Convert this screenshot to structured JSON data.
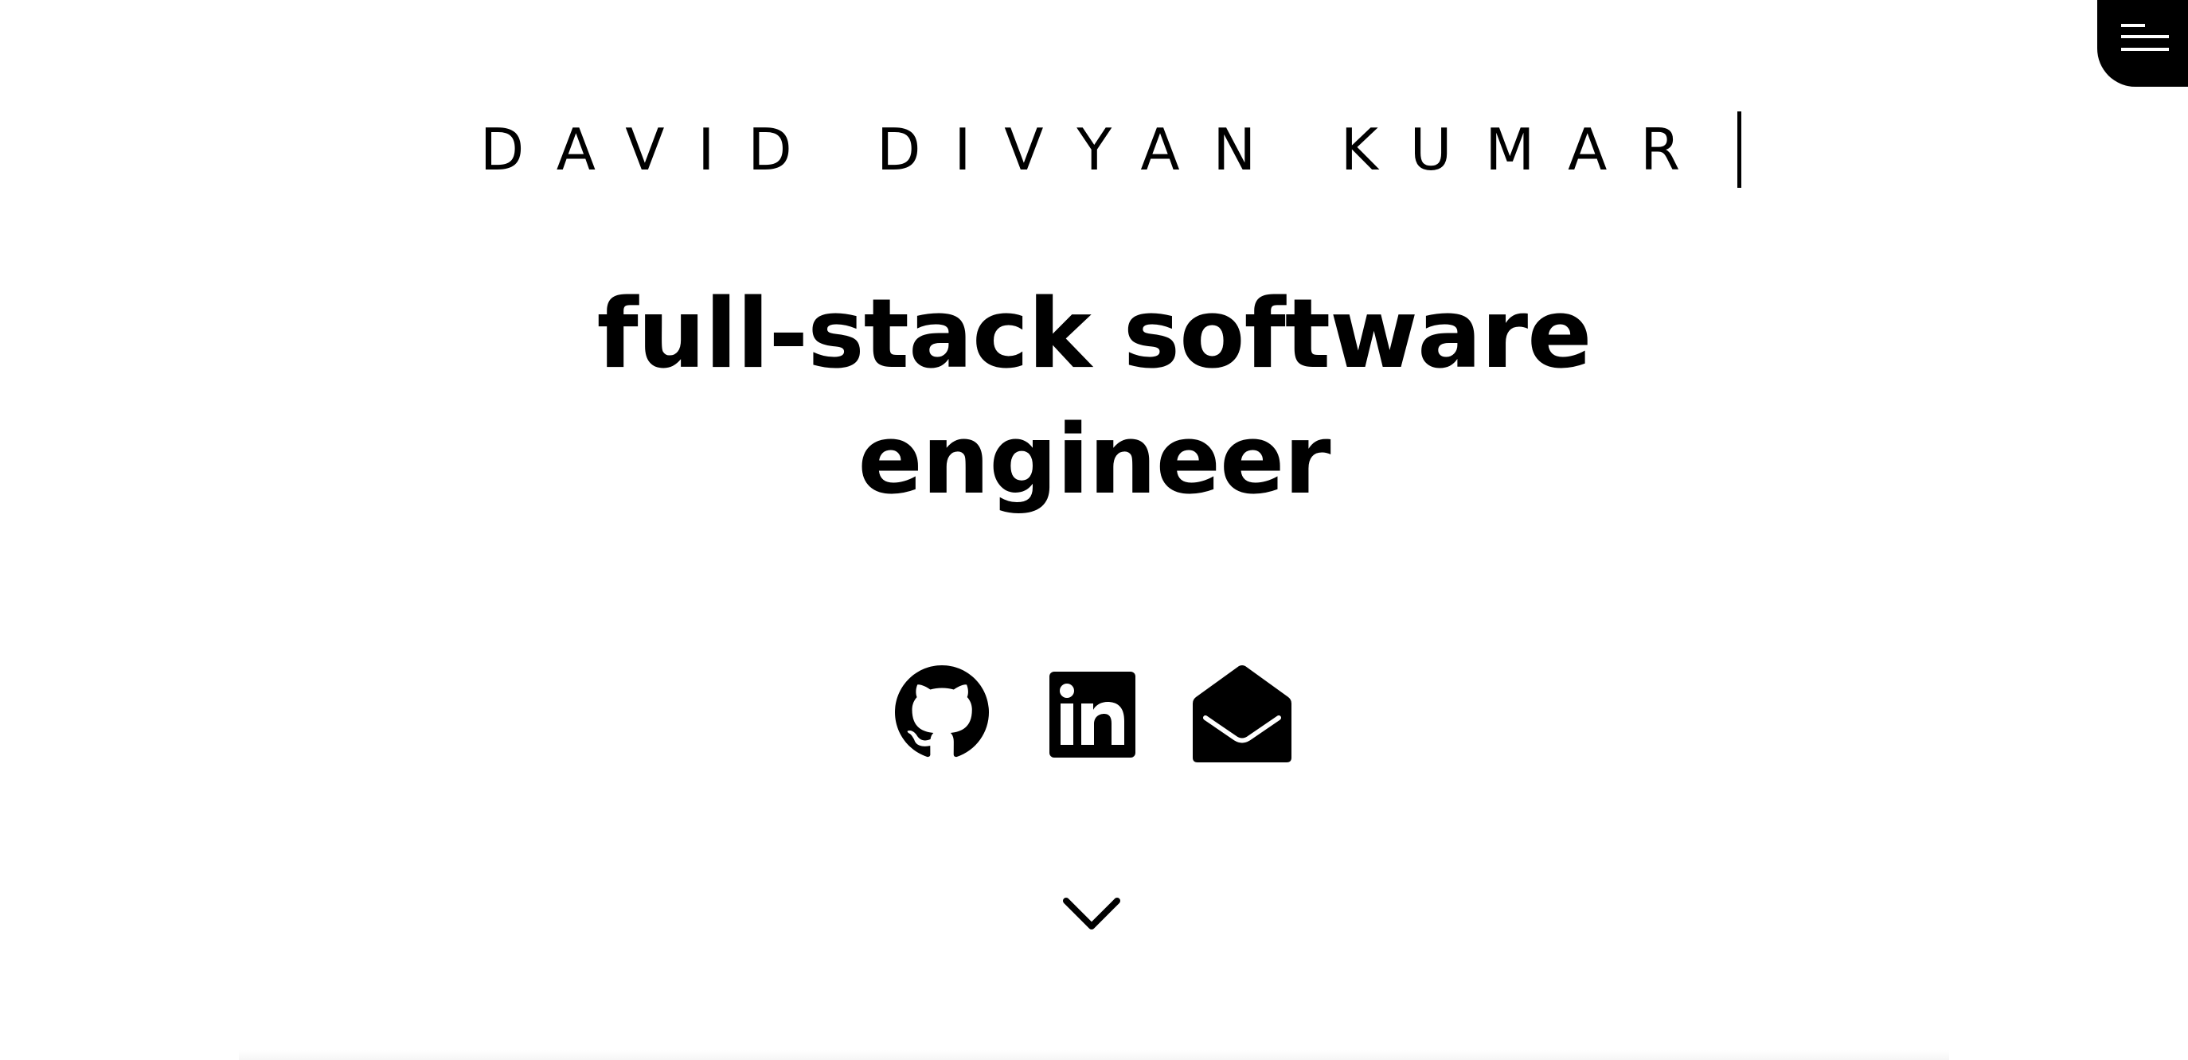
{
  "header": {
    "name": "DAVID DIVYAN KUMAR",
    "menu_icon": "menu-lines-icon"
  },
  "hero": {
    "headline_line1": "full-stack software",
    "headline_line2": "engineer"
  },
  "socials": [
    {
      "icon": "github-icon"
    },
    {
      "icon": "linkedin-icon"
    },
    {
      "icon": "email-envelope-icon"
    }
  ],
  "scroll": {
    "icon": "chevron-down-icon"
  },
  "colors": {
    "background": "#ffffff",
    "foreground": "#000000"
  }
}
